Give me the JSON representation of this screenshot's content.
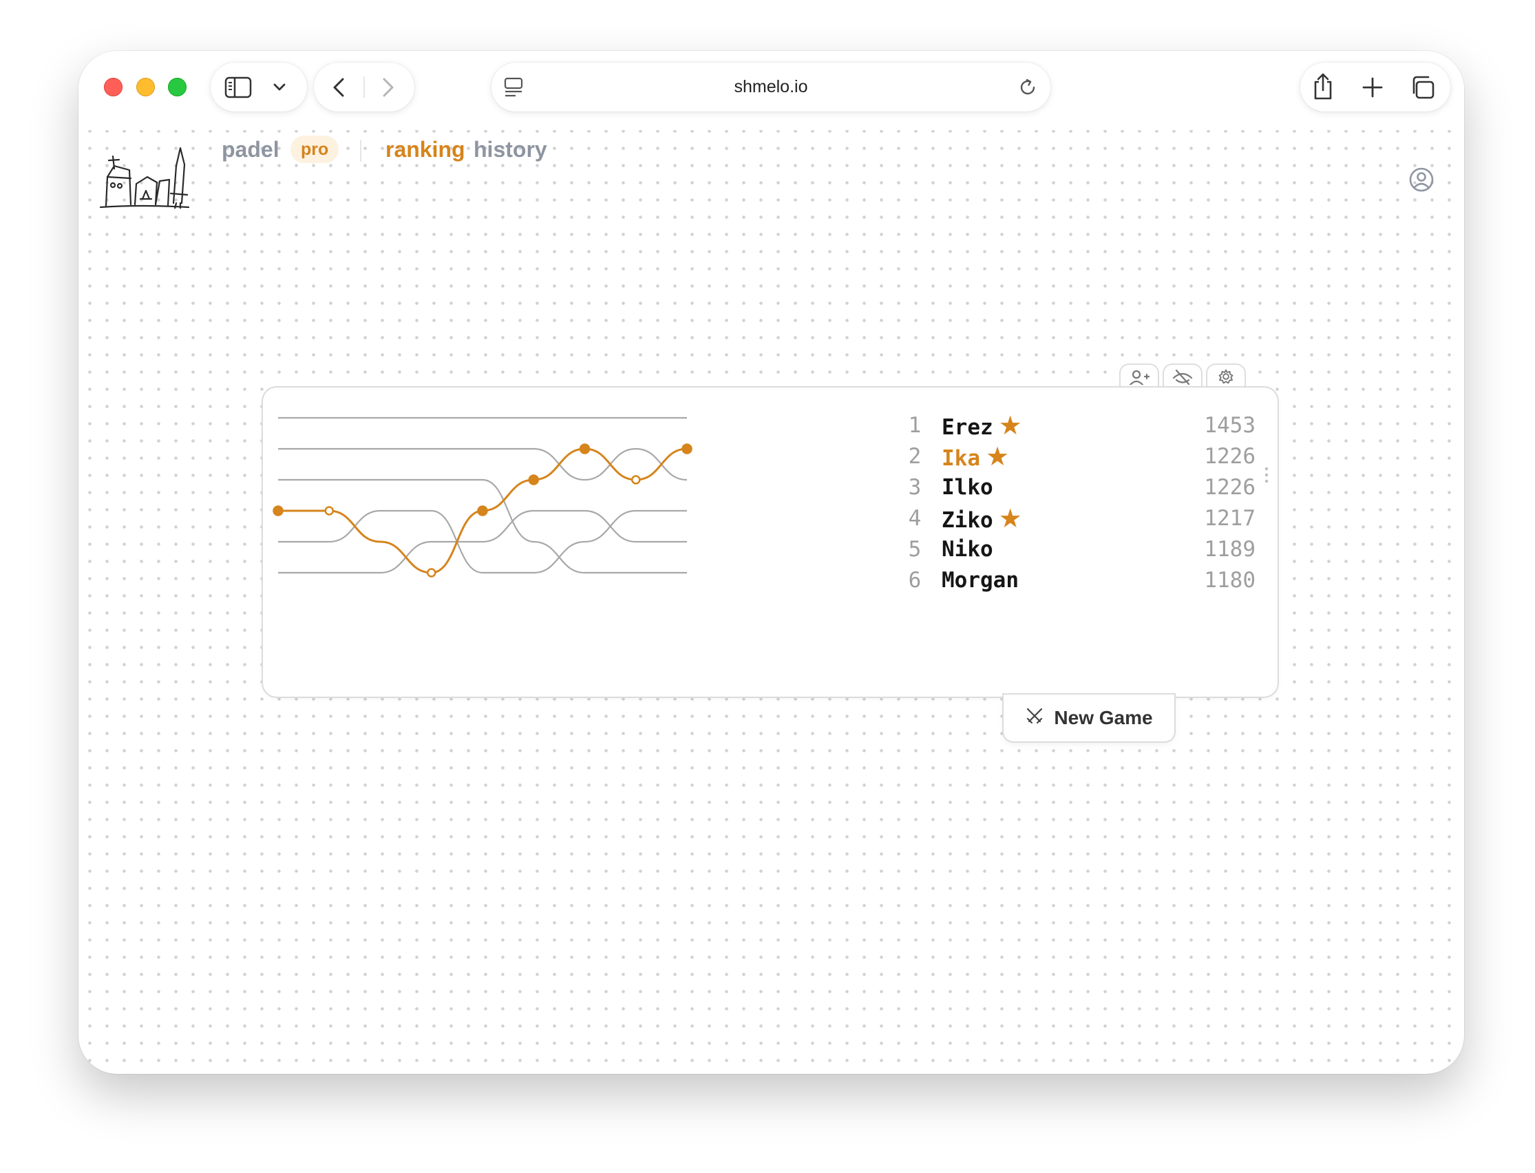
{
  "browser": {
    "url": "shmelo.io"
  },
  "app": {
    "brand": "padel",
    "badge": "pro",
    "nav": [
      {
        "label": "ranking",
        "active": true
      },
      {
        "label": "history",
        "active": false
      }
    ]
  },
  "colors": {
    "accent": "#d6841c",
    "muted_line": "#a8a8a8",
    "text": "#161616"
  },
  "icons": {
    "add_player": "user-plus-icon",
    "hide": "eye-off-icon",
    "settings": "gear-icon",
    "new_game": "crossed-swords-icon",
    "account": "user-circle-icon"
  },
  "leaderboard": {
    "highlighted_rank": 2,
    "players": [
      {
        "rank": "1",
        "name": "Erez",
        "star": true,
        "rating": "1453"
      },
      {
        "rank": "2",
        "name": "Ika",
        "star": true,
        "rating": "1226"
      },
      {
        "rank": "3",
        "name": "Ilko",
        "star": false,
        "rating": "1226"
      },
      {
        "rank": "4",
        "name": "Ziko",
        "star": true,
        "rating": "1217"
      },
      {
        "rank": "5",
        "name": "Niko",
        "star": false,
        "rating": "1189"
      },
      {
        "rank": "6",
        "name": "Morgan",
        "star": false,
        "rating": "1180"
      }
    ]
  },
  "chart_data": {
    "type": "line",
    "x": [
      0,
      1,
      2,
      3,
      4,
      5,
      6,
      7,
      8
    ],
    "ylim": [
      1,
      6
    ],
    "y_reversed": true,
    "series": [
      {
        "name": "Erez",
        "values": [
          1,
          1,
          1,
          1,
          1,
          1,
          1,
          1,
          1
        ],
        "highlight": false
      },
      {
        "name": "Ika",
        "values": [
          4,
          4,
          5,
          6,
          4,
          3,
          2,
          3,
          2
        ],
        "highlight": true,
        "markers": [
          "filled",
          "hollow",
          "none",
          "hollow",
          "filled",
          "filled",
          "filled",
          "hollow",
          "filled"
        ]
      },
      {
        "name": "Ilko",
        "values": [
          2,
          2,
          2,
          2,
          2,
          2,
          3,
          2,
          3
        ],
        "highlight": false
      },
      {
        "name": "Ziko",
        "values": [
          5,
          5,
          4,
          4,
          6,
          6,
          5,
          4,
          4
        ],
        "highlight": false
      },
      {
        "name": "Niko",
        "values": [
          6,
          6,
          6,
          5,
          5,
          4,
          4,
          5,
          5
        ],
        "highlight": false
      },
      {
        "name": "Morgan",
        "values": [
          3,
          3,
          3,
          3,
          3,
          5,
          6,
          6,
          6
        ],
        "highlight": false
      }
    ]
  },
  "actions": {
    "new_game_label": "New Game"
  }
}
